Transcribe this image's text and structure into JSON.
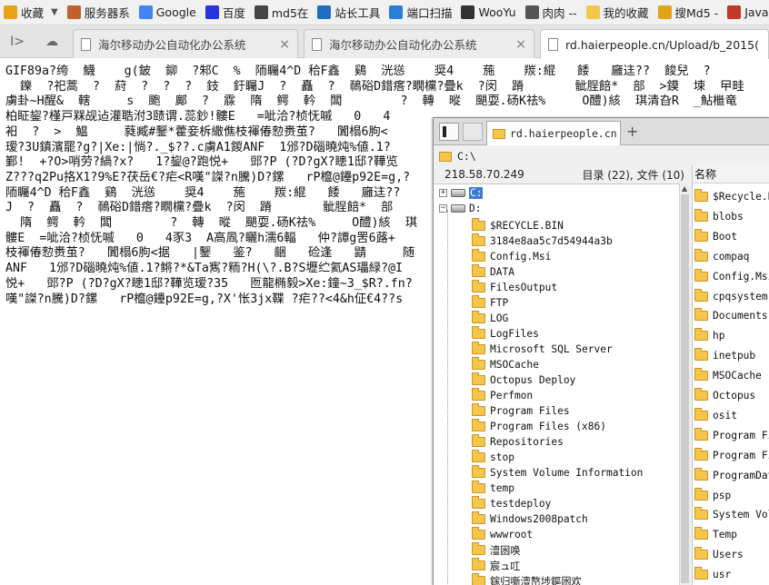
{
  "bookmarks": [
    {
      "label": "收藏",
      "icon": "star-icon",
      "color": "#e8a317",
      "has_caret": true
    },
    {
      "label": "服务器系",
      "icon": "tools-icon",
      "color": "#c0622b"
    },
    {
      "label": "Google",
      "icon": "google-icon",
      "color": "#4285f4"
    },
    {
      "label": "百度",
      "icon": "baidu-icon",
      "color": "#2932e1"
    },
    {
      "label": "md5在",
      "icon": "grid-icon",
      "color": "#444444"
    },
    {
      "label": "站长工具",
      "icon": "site-tool-icon",
      "color": "#1e6fbf"
    },
    {
      "label": "端口扫描",
      "icon": "port-scan-icon",
      "color": "#2a7fd4"
    },
    {
      "label": "WooYu",
      "icon": "wooyun-icon",
      "color": "#333333"
    },
    {
      "label": "肉肉 --",
      "icon": "page-icon",
      "color": "#555555"
    },
    {
      "label": "我的收藏",
      "icon": "folder-icon",
      "color": "#f5c64a"
    },
    {
      "label": "搜Md5 -",
      "icon": "search-md5-icon",
      "color": "#e2a21a"
    },
    {
      "label": "JavaSc",
      "icon": "w3-icon",
      "color": "#c0392b"
    }
  ],
  "tabs": [
    {
      "label": "海尔移动办公自动化办公系统",
      "active": false
    },
    {
      "label": "海尔移动办公自动化办公系统",
      "active": false
    },
    {
      "label": "rd.haierpeople.cn/Upload/b_2015(",
      "active": true
    }
  ],
  "page_lines": [
    "GIF89a?绔  鱴    g(鈹  鉚  ?邾C  %  陑矚4^D 秴F鑫  鷄  洸慫    奨4    葹    羰:緄   餧   廱迬??  餕兒  ?",
    "  鑠  ?祀蒿  ?  葤  ?  ?  ?  鈘  釪矚J  ?  矗  ?  鳾硲D錯瘩?瞯欓?疊k  ?闵  蹐       骴脭餢*  部  >鏌  堜  曱畦",
    "虜卦~H醒&  轄     s  颮  鄺  ?  霡  隋  鳄  軡  闆        ?  轉  暰  颶耍.砀K祛%     O醴)絯  琪清旮R  _鮎檵竜",
    "柏眐鋆?槿戸槑觇迠灌聕泭3赜谓.蕊鈔!髏E   =呲洽?桢怃嘁   0   4",
    "衵  ?  >  鰛     蕤臧#鑋*藿妾柝繖僬枝褌偆愸赉茧?   闐榻6朐<",
    "瑷?3U鎮濱罷?g?|Xe:|惝?._$??.c虜A1鍐ANF  1邠?D碯曉炖%値.1?",
    "鄞!  +?O>哨劳?緺?x?   1?鋆@?跑悦+   郖?P (?D?gX?瞣1邸?鞾览",
    "Z???q2Pu挌X1?9%E?茯岳€?疟<R嘆\"謋?n騰)D?鏍   rP檶@鑸p92E=g,?",
    "陑矚4^D 秴F鑫  鷄  洸慫    奨4    葹    羰:緄   餧   廱迬??",
    "J  ?  矗  ?  鳾硲D錯瘩?瞯欓?疊k  ?闵  蹐       骴脭餢*  部",
    "  隋  鳄  軡  闆        ?  轉  暰  颶耍.砀K祛%     O醴)絯  琪",
    "髏E  =呲洽?桢怃嘁   0   4豕3  A高凮?矖h濡6輻   仲?譚g罟6蕗+",
    "枝褌偆愸赉茧?   闐榻6朐<据   |鑋   鉴?   齫   硷逢   鼱     随",
    "ANF   1邠?D碯曉炖%値.1?鳉?*&Ta寯?粫?H(\\?.B?S壢纻氦AS瓃緑?@I",
    "悦+   郖?P (?D?gX?瞣1邸?鞾览瑷?35   匢龍椭毅>Xe:鐘~3_$R?.fn?",
    "嘆\"謋?n騰)D?鏍   rP檶@鑸p92E=g,?X'怅3jx鞢 ?疟??<4&h佂€4??s"
  ],
  "file_manager": {
    "tab_label": "rd.haierpeople.cn",
    "path": "C:\\",
    "server_ip": "218.58.70.249",
    "count_text": "目录 (22), 文件 (10)",
    "drives": [
      {
        "label": "C:",
        "expanded": false,
        "selected": true
      },
      {
        "label": "D:",
        "expanded": true,
        "selected": false
      }
    ],
    "tree_folders": [
      "$RECYCLE.BIN",
      "3184e8aa5c7d54944a3b",
      "Config.Msi",
      "DATA",
      "FilesOutput",
      "FTP",
      "LOG",
      "LogFiles",
      "Microsoft SQL Server",
      "MSOCache",
      "Octopus Deploy",
      "Perfmon",
      "Program Files",
      "Program Files (x86)",
      "Repositories",
      "stop",
      "System Volume Information",
      "temp",
      "testdeploy",
      "Windows2008patch",
      "wwwroot",
      "澶囦唤",
      "宸ュ叿",
      "鎵归噺澶嶅埗鏂囦欢"
    ],
    "list_header": "名称",
    "list_items": [
      "$Recycle.Bin",
      "blobs",
      "Boot",
      "compaq",
      "Config.Msi",
      "cpqsystem",
      "Documents and",
      "hp",
      "inetpub",
      "MSOCache",
      "Octopus",
      "osit",
      "Program Files",
      "Program Files",
      "ProgramData",
      "psp",
      "System Volume",
      "Temp",
      "Users",
      "usr"
    ]
  }
}
